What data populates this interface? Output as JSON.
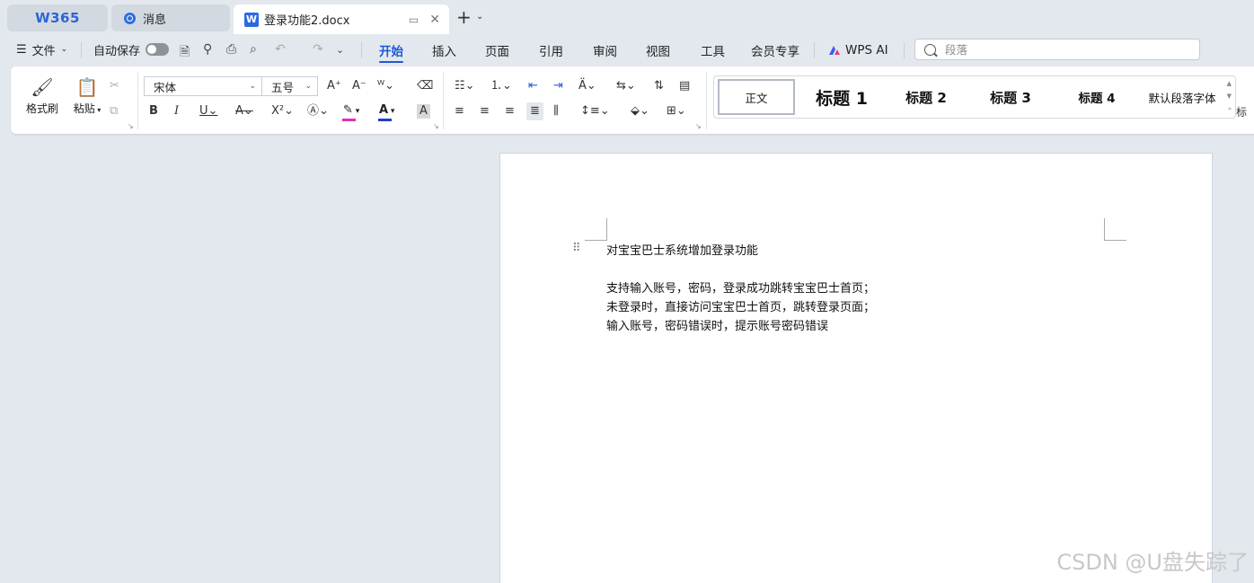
{
  "tabs": {
    "brand": "W365",
    "messages": "消息",
    "document": "登录功能2.docx"
  },
  "menu": {
    "file": "文件",
    "autosave": "自动保存",
    "ribbon_tabs": [
      "开始",
      "插入",
      "页面",
      "引用",
      "审阅",
      "视图",
      "工具",
      "会员专享"
    ],
    "active_tab": "开始",
    "wps_ai": "WPS AI",
    "search_placeholder": "段落"
  },
  "ribbon": {
    "format_painter": "格式刷",
    "paste": "粘贴",
    "font_name": "宋体",
    "font_size": "五号",
    "styles": [
      "正文",
      "标题 1",
      "标题 2",
      "标题 3",
      "标题 4",
      "默认段落字体"
    ],
    "style_cut": "标"
  },
  "colors": {
    "accent": "#1f57d6",
    "highlight": "#e62eb8",
    "font_color": "#1f3fcc"
  },
  "document": {
    "lines": [
      "对宝宝巴士系统增加登录功能",
      "支持输入账号，密码，登录成功跳转宝宝巴士首页；",
      "未登录时，直接访问宝宝巴士首页，跳转登录页面；",
      "输入账号，密码错误时，提示账号密码错误"
    ]
  },
  "watermark": "CSDN @U盘失踪了"
}
